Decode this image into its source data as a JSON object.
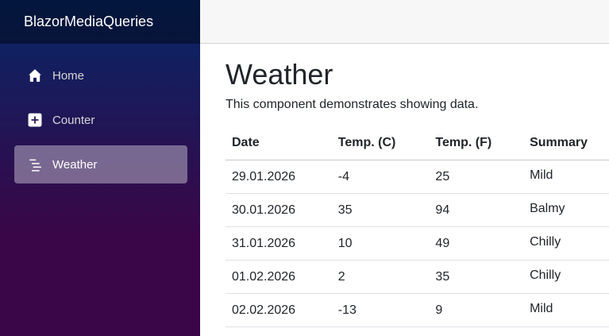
{
  "app": {
    "brand": "BlazorMediaQueries"
  },
  "sidebar": {
    "items": [
      {
        "label": "Home",
        "icon": "house-icon",
        "active": false
      },
      {
        "label": "Counter",
        "icon": "plus-square-icon",
        "active": false
      },
      {
        "label": "Weather",
        "icon": "list-nested-icon",
        "active": true
      }
    ]
  },
  "page": {
    "title": "Weather",
    "description": "This component demonstrates showing data."
  },
  "table": {
    "columns": [
      "Date",
      "Temp. (C)",
      "Temp. (F)",
      "Summary"
    ],
    "rows": [
      [
        "29.01.2026",
        "-4",
        "25",
        "Mild"
      ],
      [
        "30.01.2026",
        "35",
        "94",
        "Balmy"
      ],
      [
        "31.01.2026",
        "10",
        "49",
        "Chilly"
      ],
      [
        "01.02.2026",
        "2",
        "35",
        "Chilly"
      ],
      [
        "02.02.2026",
        "-13",
        "9",
        "Mild"
      ]
    ]
  },
  "colors": {
    "sidebar_top": "#052767",
    "sidebar_bottom": "#3a0647",
    "active_item": "rgba(255,255,255,0.37)"
  }
}
